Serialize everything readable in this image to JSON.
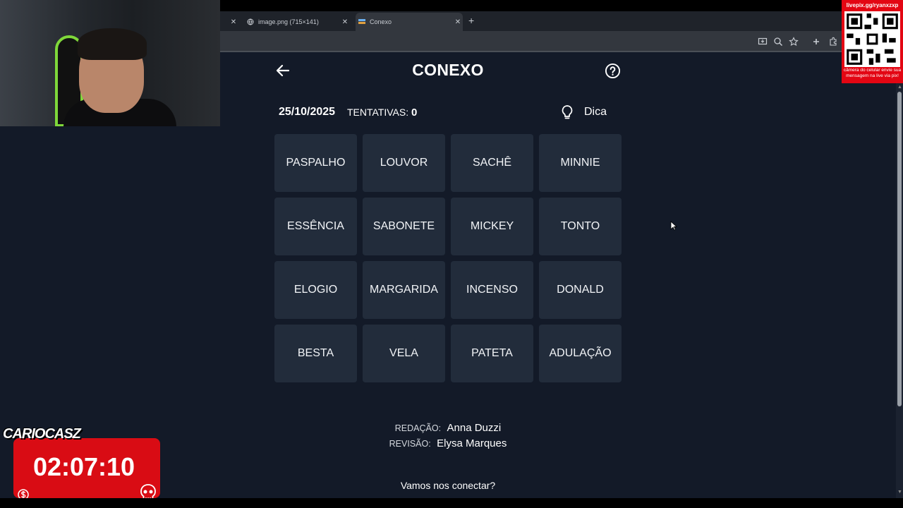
{
  "browser": {
    "tabs": [
      {
        "title": ""
      },
      {
        "title": "image.png (715×141)"
      },
      {
        "title": "Conexo"
      }
    ]
  },
  "overlay": {
    "qr_url": "livepix.gg/ryanxzxp",
    "qr_caption": "câmera do celular envie sua mensagem na live via pix!",
    "timer_brand": "CARIOCASZ",
    "timer": "02:07:10"
  },
  "game": {
    "title": "CONEXO",
    "date": "25/10/2025",
    "attempts_label": "TENTATIVAS:",
    "attempts_count": "0",
    "hint_label": "Dica",
    "tiles": [
      "PASPALHO",
      "LOUVOR",
      "SACHÊ",
      "MINNIE",
      "ESSÊNCIA",
      "SABONETE",
      "MICKEY",
      "TONTO",
      "ELOGIO",
      "MARGARIDA",
      "INCENSO",
      "DONALD",
      "BESTA",
      "VELA",
      "PATETA",
      "ADULAÇÃO"
    ],
    "credits": [
      {
        "role": "REDAÇÃO:",
        "name": "Anna Duzzi"
      },
      {
        "role": "REVISÃO:",
        "name": "Elysa Marques"
      }
    ],
    "connect_text": "Vamos nos conectar?"
  },
  "colors": {
    "background": "#131a28",
    "tile": "#222c3b",
    "overlay_red": "#d90c14"
  }
}
